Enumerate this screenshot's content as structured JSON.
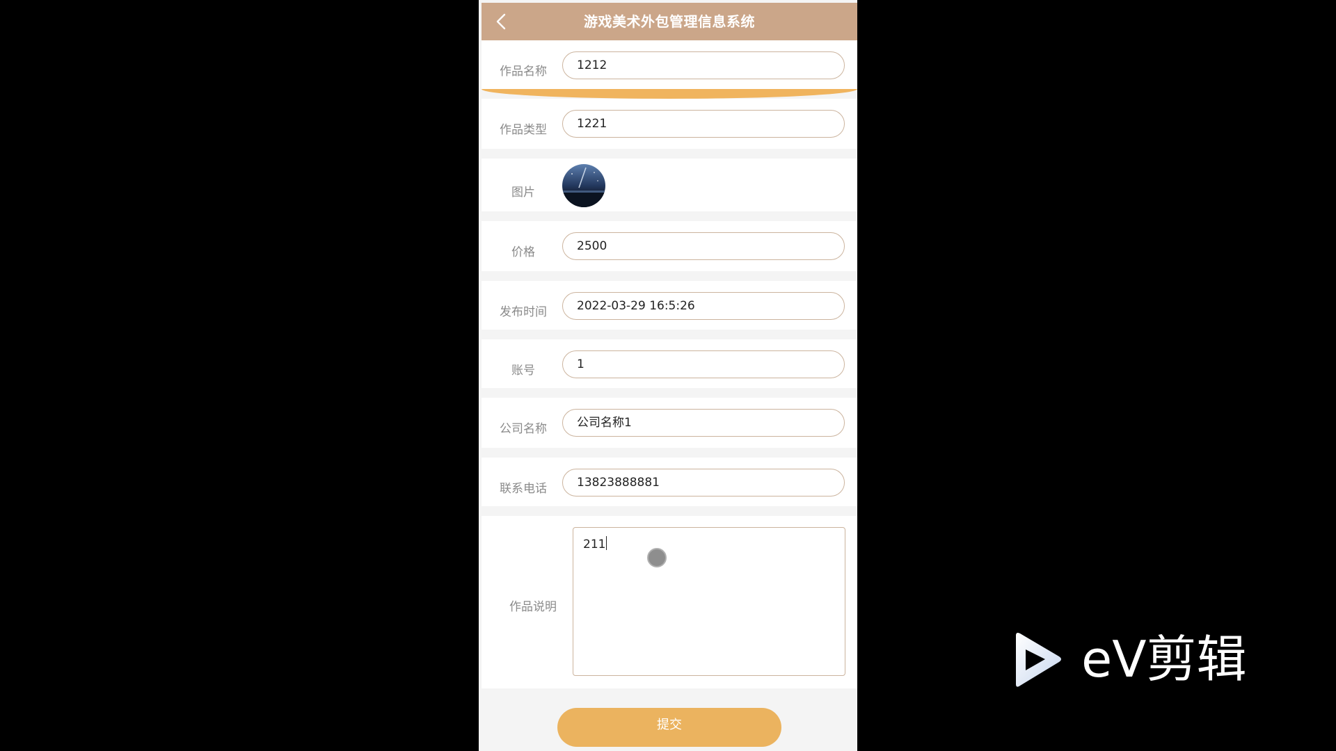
{
  "header": {
    "title": "游戏美术外包管理信息系统",
    "back_icon": "chevron-left-icon"
  },
  "form": {
    "work_name": {
      "label": "作品名称",
      "value": "1212"
    },
    "work_type": {
      "label": "作品类型",
      "value": "1221"
    },
    "image": {
      "label": "图片",
      "thumbnail": "night-sky-image"
    },
    "price": {
      "label": "价格",
      "value": "2500"
    },
    "publish_time": {
      "label": "发布时间",
      "value": "2022-03-29 16:5:26"
    },
    "account": {
      "label": "账号",
      "value": "1"
    },
    "company_name": {
      "label": "公司名称",
      "value": "公司名称1"
    },
    "phone": {
      "label": "联系电话",
      "value": "13823888881"
    },
    "description": {
      "label": "作品说明",
      "value": "211"
    }
  },
  "submit_label": "提交",
  "watermark": {
    "text": "eV剪辑",
    "icon": "play-logo-icon"
  },
  "colors": {
    "header_bg": "#cba689",
    "accent_orange": "#ebb35f",
    "field_border": "#cbb39d",
    "label_text": "#8a8a8a"
  }
}
